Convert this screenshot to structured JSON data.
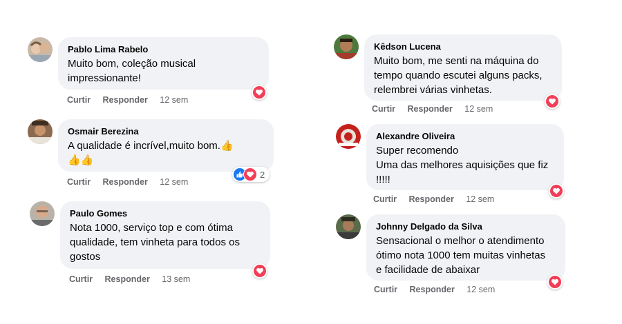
{
  "colors": {
    "bubble_bg": "#f0f2f5",
    "meta_text": "#65676b",
    "like_blue": "#1877f2",
    "love_red": "#f33e58"
  },
  "comments": [
    {
      "author": "Pablo Lima Rabelo",
      "lines": [
        "Muito bom, coleção musical",
        "impressionante!"
      ],
      "like_label": "Curtir",
      "reply_label": "Responder",
      "time": "12 sem",
      "reactions": [
        "love-icon"
      ],
      "reaction_count": ""
    },
    {
      "author": "Osmair Berezina",
      "lines": [
        "A qualidade é incrível,muito bom.👍",
        "👍👍"
      ],
      "like_label": "Curtir",
      "reply_label": "Responder",
      "time": "12 sem",
      "reactions": [
        "like-icon",
        "love-icon"
      ],
      "reaction_count": "2"
    },
    {
      "author": "Paulo Gomes",
      "lines": [
        "Nota 1000, serviço top e com ótima",
        "qualidade, tem vinheta para todos os",
        "gostos"
      ],
      "like_label": "Curtir",
      "reply_label": "Responder",
      "time": "13 sem",
      "reactions": [
        "love-icon"
      ],
      "reaction_count": ""
    },
    {
      "author": "Kêdson Lucena",
      "lines": [
        "Muito bom, me senti na máquina do",
        "tempo quando escutei alguns packs,",
        "relembrei várias vinhetas."
      ],
      "like_label": "Curtir",
      "reply_label": "Responder",
      "time": "12 sem",
      "reactions": [
        "love-icon"
      ],
      "reaction_count": ""
    },
    {
      "author": "Alexandre Oliveira",
      "lines": [
        "Super recomendo",
        "Uma das melhores aquisições que fiz",
        "!!!!!"
      ],
      "like_label": "Curtir",
      "reply_label": "Responder",
      "time": "12 sem",
      "reactions": [
        "love-icon"
      ],
      "reaction_count": ""
    },
    {
      "author": "Johnny Delgado da Silva",
      "lines": [
        "Sensacional o melhor o atendimento",
        "ótimo nota 1000 tem muitas vinhetas",
        "e facilidade de abaixar"
      ],
      "like_label": "Curtir",
      "reply_label": "Responder",
      "time": "12 sem",
      "reactions": [
        "love-icon"
      ],
      "reaction_count": ""
    }
  ]
}
